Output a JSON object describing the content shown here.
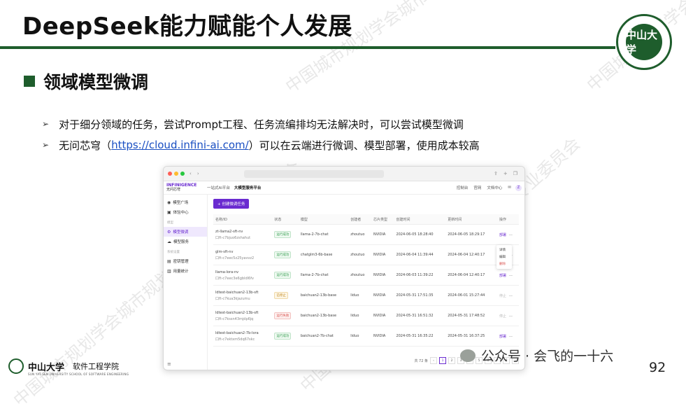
{
  "title": "DeepSeek能力赋能个人发展",
  "logo_top_right": {
    "text": "中山大学",
    "sub": "SUN YAT-SEN UNIVERSITY"
  },
  "section_heading": "领域模型微调",
  "bullets": [
    {
      "before": "对于细分领域的任务，尝试Prompt工程、任务流编排均无法解决时，可以尝试模型微调",
      "link": "",
      "after": ""
    },
    {
      "before": "无问芯穹（",
      "link": "https://cloud.infini-ai.com/",
      "after": "）可以在云端进行微调、模型部署，使用成本较高"
    }
  ],
  "app": {
    "brand_top": "INFINIGENCE",
    "brand_bottom": "无问芯穹",
    "tabs": [
      "一站式AI平台",
      "大模型服务平台"
    ],
    "header_right": [
      "控制台",
      "官网",
      "文档中心"
    ],
    "avatar": "Z",
    "sidebar": {
      "items": [
        {
          "label": "模型广场",
          "icon": "grid-icon"
        },
        {
          "label": "体验中心",
          "icon": "chat-icon"
        }
      ],
      "section_label": "模型",
      "model_items": [
        {
          "label": "模型微调",
          "active": true
        },
        {
          "label": "模型服务",
          "active": false
        }
      ],
      "section2_label": "系统设置",
      "setting_items": [
        {
          "label": "密钥管理"
        },
        {
          "label": "用量统计"
        }
      ]
    },
    "create_button": "+ 创建微调任务",
    "table_headers": [
      "名称/ID",
      "状态",
      "模型",
      "创建者",
      "芯片类型",
      "创建时间",
      "更新时间",
      "操作"
    ],
    "rows": [
      {
        "name": "zt-llama2-sft-nv",
        "id": "口ft-c7bjuo6zshahut",
        "status": "运行成功",
        "status_type": "run",
        "model": "llama-2-7b-chat",
        "creator": "zhoutuo",
        "chip": "NVIDIA",
        "created": "2024-06-05 18:28:40",
        "updated": "2024-06-05 18:29:17",
        "op": "部署"
      },
      {
        "name": "glm-sft-nv",
        "id": "口ft-c7eec5z25yavvz2",
        "status": "运行成功",
        "status_type": "run",
        "model": "chatglm3-6b-base",
        "creator": "zhoutuo",
        "chip": "NVIDIA",
        "created": "2024-06-04 11:39:44",
        "updated": "2024-06-04 12:40:17",
        "op": "部署"
      },
      {
        "name": "llama-lora-nv",
        "id": "口ft-c7eec3e6gbldl6fv",
        "status": "运行成功",
        "status_type": "run",
        "model": "llama-2-7b-chat",
        "creator": "zhoutuo",
        "chip": "NVIDIA",
        "created": "2024-06-03 11:39:22",
        "updated": "2024-06-04 12:40:17",
        "op": "部署"
      },
      {
        "name": "ldtest-baichuan2-13b-sft",
        "id": "口ft-c7kua3kjazumu",
        "status": "已停止",
        "status_type": "done",
        "model": "baichuan2-13b-base",
        "creator": "liduo",
        "chip": "NVIDIA",
        "created": "2024-05-31 17:51:35",
        "updated": "2024-06-01 15:27:44",
        "op": "停止"
      },
      {
        "name": "ldtest-baichuan2-13b-sft",
        "id": "口ft-c7kssn43mjdp6jq",
        "status": "运行失败",
        "status_type": "fail",
        "model": "baichuan2-13b-base",
        "creator": "liduo",
        "chip": "NVIDIA",
        "created": "2024-05-31 16:51:32",
        "updated": "2024-05-31 17:48:52",
        "op": "停止"
      },
      {
        "name": "ldtest-baichuan2-7b-lora",
        "id": "口ft-c7ektxm5dq67skc",
        "status": "运行成功",
        "status_type": "run",
        "model": "baichuan2-7b-chat",
        "creator": "liduo",
        "chip": "NVIDIA",
        "created": "2024-05-31 16:35:22",
        "updated": "2024-05-31 16:37:25",
        "op": "部署"
      }
    ],
    "popup_items": [
      "详情",
      "编辑",
      "删除"
    ],
    "pager_total": "共 72 条",
    "pages": [
      "1",
      "2",
      "3",
      "4",
      "5",
      "6",
      "7",
      "8"
    ]
  },
  "footer": {
    "university": "中山大学",
    "university_en": "SUN YAT-SEN UNIVERSITY  SCHOOL OF SOFTWARE ENGINEERING",
    "school": "软件工程学院",
    "account": "公众号 · 会飞的一十六",
    "page_number": "92"
  },
  "watermark": "中国城市规划学会城市规划新技术应用专业委员会"
}
